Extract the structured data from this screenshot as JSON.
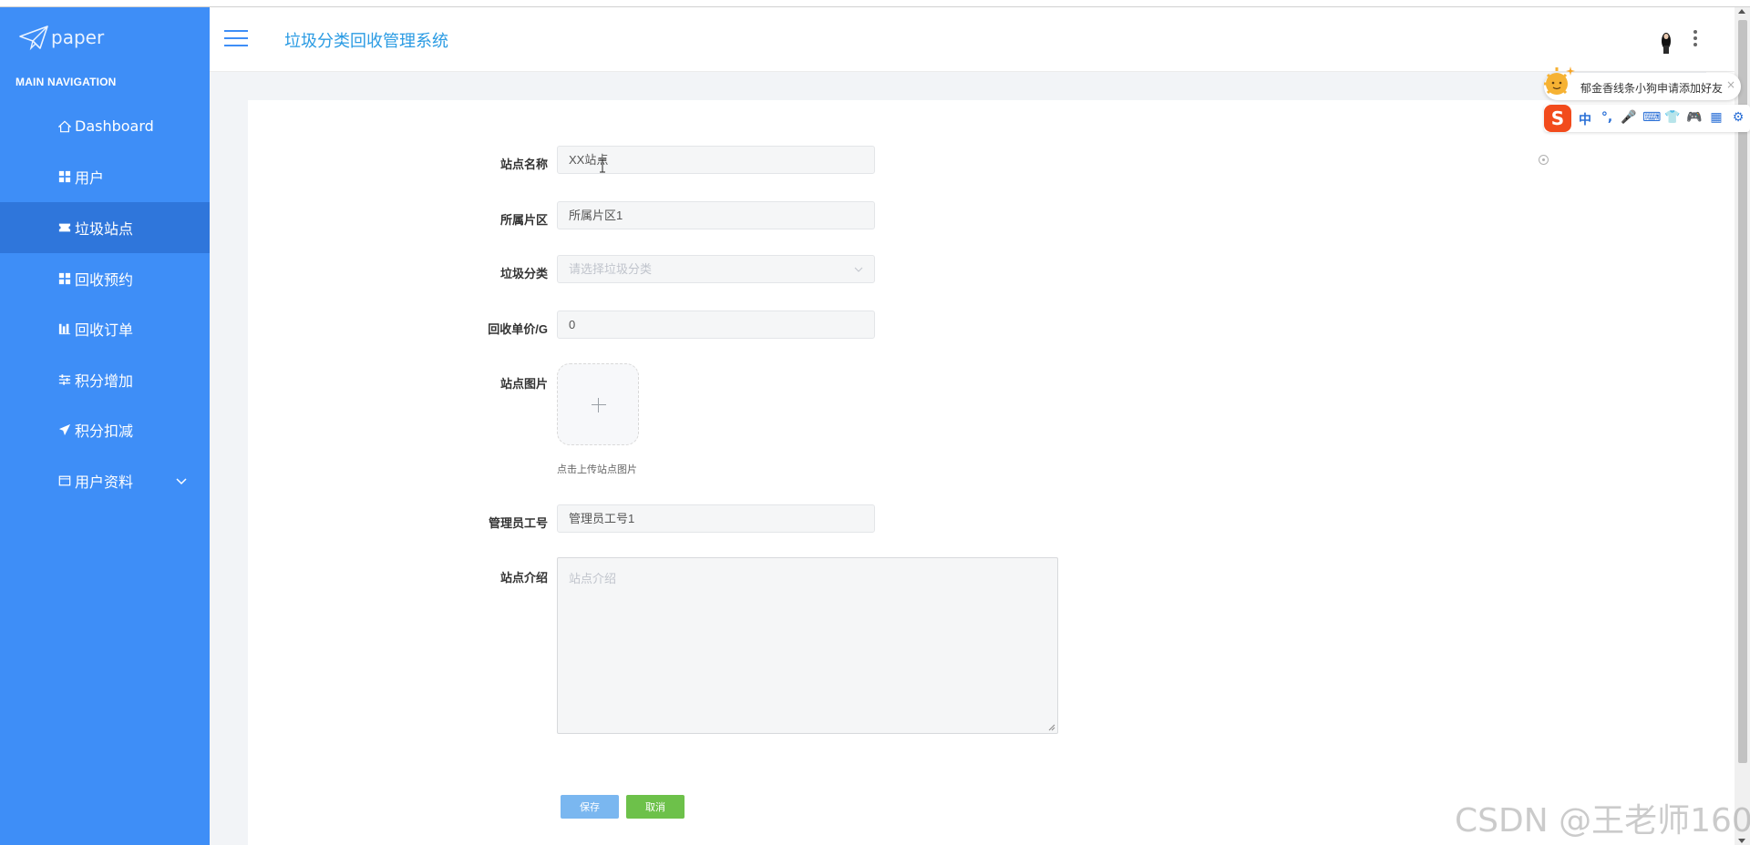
{
  "sidebar": {
    "logo_text": "paper",
    "nav_header": "MAIN NAVIGATION",
    "items": [
      {
        "label": "Dashboard",
        "icon": "home-icon"
      },
      {
        "label": "用户",
        "icon": "grid-icon"
      },
      {
        "label": "垃圾站点",
        "icon": "ticket-icon",
        "active": true
      },
      {
        "label": "回收预约",
        "icon": "grid-icon"
      },
      {
        "label": "回收订单",
        "icon": "bar-chart-icon"
      },
      {
        "label": "积分增加",
        "icon": "sliders-icon"
      },
      {
        "label": "积分扣减",
        "icon": "paper-plane-icon"
      },
      {
        "label": "用户资料",
        "icon": "window-icon",
        "expandable": true
      }
    ]
  },
  "header": {
    "title": "垃圾分类回收管理系统"
  },
  "form": {
    "name": {
      "label": "站点名称",
      "value": "XX站点"
    },
    "area": {
      "label": "所属片区",
      "value": "所属片区1"
    },
    "category": {
      "label": "垃圾分类",
      "placeholder": "请选择垃圾分类"
    },
    "price": {
      "label": "回收单价/G",
      "value": "0"
    },
    "image": {
      "label": "站点图片",
      "tip": "点击上传站点图片"
    },
    "admin": {
      "label": "管理员工号",
      "value": "管理员工号1"
    },
    "intro": {
      "label": "站点介绍",
      "placeholder": "站点介绍"
    },
    "save_label": "保存",
    "cancel_label": "取消"
  },
  "ime": {
    "bubble_text": "郁金香线条小狗申请添加好友",
    "logo": "S",
    "toolbar": [
      "中",
      "°,",
      "🎤",
      "⌨",
      "👕",
      "🎮",
      "▦",
      "⚙"
    ]
  },
  "watermark": "CSDN @王老师160",
  "colors": {
    "sidebar": "#3e8ef7",
    "sidebar_active": "#2f76db",
    "title": "#2a9be3",
    "save": "#7ab7f0",
    "cancel": "#6dc14a"
  }
}
